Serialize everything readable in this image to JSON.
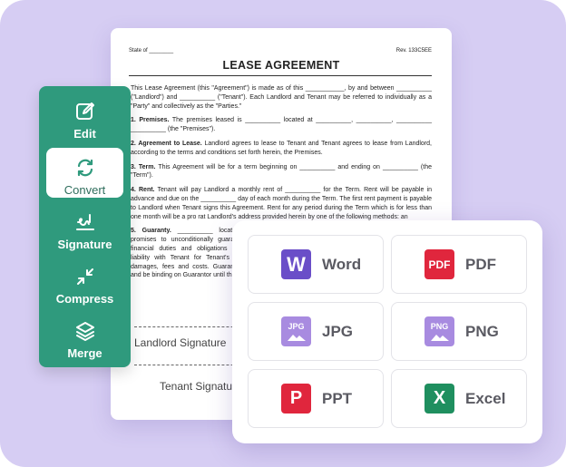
{
  "document": {
    "state_label": "State of ________",
    "rev_label": "Rev. 133C5EE",
    "title": "LEASE AGREEMENT",
    "p_intro": "This Lease Agreement (this \"Agreement\") is made as of this ___________, by and between __________ (\"Landlord\") and __________ (\"Tenant\"). Each Landlord and Tenant may be referred to individually as a \"Party\" and collectively as the \"Parties.\"",
    "p1_head": "1. Premises.",
    "p1_text": " The premises leased is __________ located at __________, __________, __________ __________ (the \"Premises\").",
    "p2_head": "2. Agreement to Lease.",
    "p2_text": " Landlord agrees to lease to Tenant and Tenant agrees to lease from Landlord, according to the terms and conditions set forth herein, the Premises.",
    "p3_head": "3. Term.",
    "p3_text": " This Agreement will be for a term beginning on __________ and ending on __________ (the \"Term\").",
    "p4_head": "4. Rent.",
    "p4_text": " Tenant will pay Landlord a monthly rent of __________ for the Term. Rent will be payable in advance and due on the __________ day of each month during the Term. The first rent payment is payable to Landlord when Tenant signs this Agreement. Rent for any period during the Term which is for less than one month will be a pro rat Landlord's address provided herein by one of the following methods: an",
    "p5_head": "5. Guaranty.",
    "p5_text": " __________ located promises to unconditionally guarant financial duties and obligations ari liability with Tenant for Tenant's fa damages, fees and costs. Guaranto and be binding on Guarantor until th",
    "landlord_sig": "Landlord Signature",
    "tenant_sig": "Tenant Signature"
  },
  "tools": [
    {
      "label": "Edit",
      "icon": "edit-icon"
    },
    {
      "label": "Convert",
      "icon": "convert-icon"
    },
    {
      "label": "Signature",
      "icon": "signature-icon"
    },
    {
      "label": "Compress",
      "icon": "compress-icon"
    },
    {
      "label": "Merge",
      "icon": "merge-icon"
    }
  ],
  "active_tool": "Convert",
  "formats": [
    {
      "name": "Word",
      "badge": "W",
      "color": "#6a4ec8"
    },
    {
      "name": "PDF",
      "badge": "PDF",
      "color": "#e0263d"
    },
    {
      "name": "JPG",
      "badge": "JPG",
      "color": "#a88be0"
    },
    {
      "name": "PNG",
      "badge": "PNG",
      "color": "#a88be0"
    },
    {
      "name": "PPT",
      "badge": "P",
      "color": "#e0263d"
    },
    {
      "name": "Excel",
      "badge": "X",
      "color": "#1f8f5f"
    }
  ],
  "colors": {
    "background": "#d6cdf3",
    "sidebar": "#2f9a7d"
  }
}
